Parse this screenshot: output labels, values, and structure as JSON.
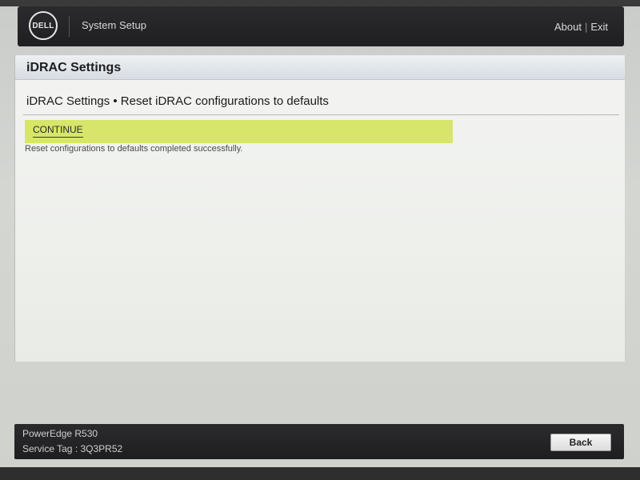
{
  "header": {
    "logo_text": "DELL",
    "title": "System Setup",
    "about_label": "About",
    "separator": "|",
    "exit_label": "Exit"
  },
  "main": {
    "section_title": "iDRAC Settings",
    "breadcrumb": "iDRAC Settings • Reset iDRAC configurations to defaults",
    "continue_label": "CONTINUE",
    "status_message": "Reset configurations to defaults completed successfully."
  },
  "footer": {
    "model": "PowerEdge R530",
    "service_tag": "Service Tag : 3Q3PR52",
    "back_label": "Back"
  },
  "colors": {
    "header_bg": "#232325",
    "highlight": "#d7e66a",
    "panel_bg": "#f0f2ee"
  }
}
